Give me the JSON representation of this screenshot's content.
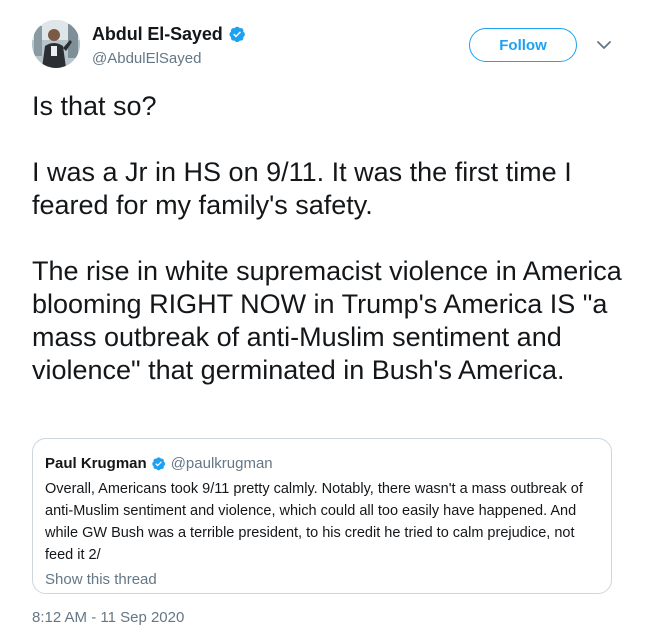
{
  "author": {
    "display_name": "Abdul El-Sayed",
    "handle": "@AbdulElSayed",
    "verified": true
  },
  "actions": {
    "follow_label": "Follow"
  },
  "icons": {
    "verified": "verified-badge-icon",
    "caret": "chevron-down-icon"
  },
  "tweet": {
    "text": "Is that so?\n\nI was a Jr in HS on 9/11. It was the first time I feared for my family's safety.\n\nThe rise in white supremacist violence in America blooming RIGHT NOW in Trump's America IS \"a mass outbreak of anti-Muslim sentiment and violence\" that germinated in Bush's America.",
    "timestamp": "8:12 AM - 11 Sep 2020"
  },
  "quoted_tweet": {
    "display_name": "Paul Krugman",
    "handle": "@paulkrugman",
    "verified": true,
    "text": "Overall, Americans took 9/11 pretty calmly. Notably, there wasn't a mass outbreak of anti-Muslim sentiment and violence, which could all too easily have happened. And while GW Bush was a terrible president, to his credit he tried to calm prejudice, not feed it 2/",
    "show_thread_label": "Show this thread"
  },
  "colors": {
    "accent": "#1da1f2",
    "text": "#14171a",
    "muted": "#657786",
    "border": "#ccd6dd"
  }
}
